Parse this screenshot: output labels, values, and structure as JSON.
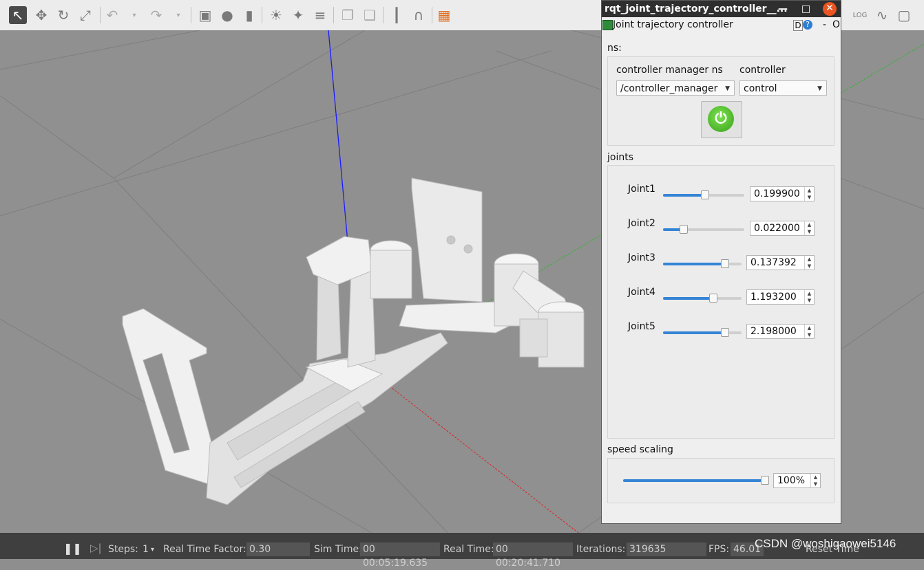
{
  "toolbar": {
    "icons": [
      "select-arrow",
      "translate",
      "rotate",
      "scale",
      "undo",
      "undo-dropdown",
      "redo",
      "redo-dropdown",
      "box",
      "sphere",
      "cylinder",
      "point-light",
      "spot-light",
      "directional-light",
      "copy",
      "paste",
      "align",
      "snap",
      "view-angle"
    ],
    "right_icons": [
      "log",
      "plot",
      "screenshot"
    ]
  },
  "rqt_window": {
    "title": "rqt_joint_trajectory_controller__...",
    "minimize": "—",
    "maximize": "□",
    "close": "✕"
  },
  "plugin": {
    "title": "Joint trajectory controller",
    "d_label": "D",
    "help_label": "?",
    "dash_label": "-",
    "close_label": "O"
  },
  "ns": {
    "label": "ns:",
    "controller_manager_label": "controller manager ns",
    "controller_label": "controller",
    "controller_manager_value": "/controller_manager",
    "controller_value": "control",
    "power_state": "on",
    "power_glyph": "⏻"
  },
  "joints": {
    "label": "joints",
    "items": [
      {
        "name": "Joint1",
        "value": "0.199900",
        "fraction": 0.52
      },
      {
        "name": "Joint2",
        "value": "0.022000",
        "fraction": 0.23
      },
      {
        "name": "Joint3",
        "value": "0.137392",
        "fraction": 0.82
      },
      {
        "name": "Joint4",
        "value": "1.193200",
        "fraction": 0.66
      },
      {
        "name": "Joint5",
        "value": "2.198000",
        "fraction": 0.82
      }
    ]
  },
  "speed": {
    "label": "speed scaling",
    "value": "100%",
    "fraction": 1.0
  },
  "status": {
    "pause_glyph": "❚❚",
    "step_glyph": "▷|",
    "steps_label": "Steps:",
    "steps_value": "1",
    "rtf_label": "Real Time Factor:",
    "rtf_value": "0.30",
    "sim_time_label": "Sim Time:",
    "sim_time_value": "00 00:05:19.635",
    "real_time_label": "Real Time:",
    "real_time_value": "00 00:20:41.710",
    "iterations_label": "Iterations:",
    "iterations_value": "319635",
    "fps_label": "FPS:",
    "fps_value": "46.01",
    "reset_label": "Reset Time"
  },
  "watermark": "CSDN @woshigaowei5146",
  "colors": {
    "accent": "#3584d6",
    "close": "#e95420",
    "power": "#4dbb2a",
    "titlebar": "#2f2f2f"
  }
}
